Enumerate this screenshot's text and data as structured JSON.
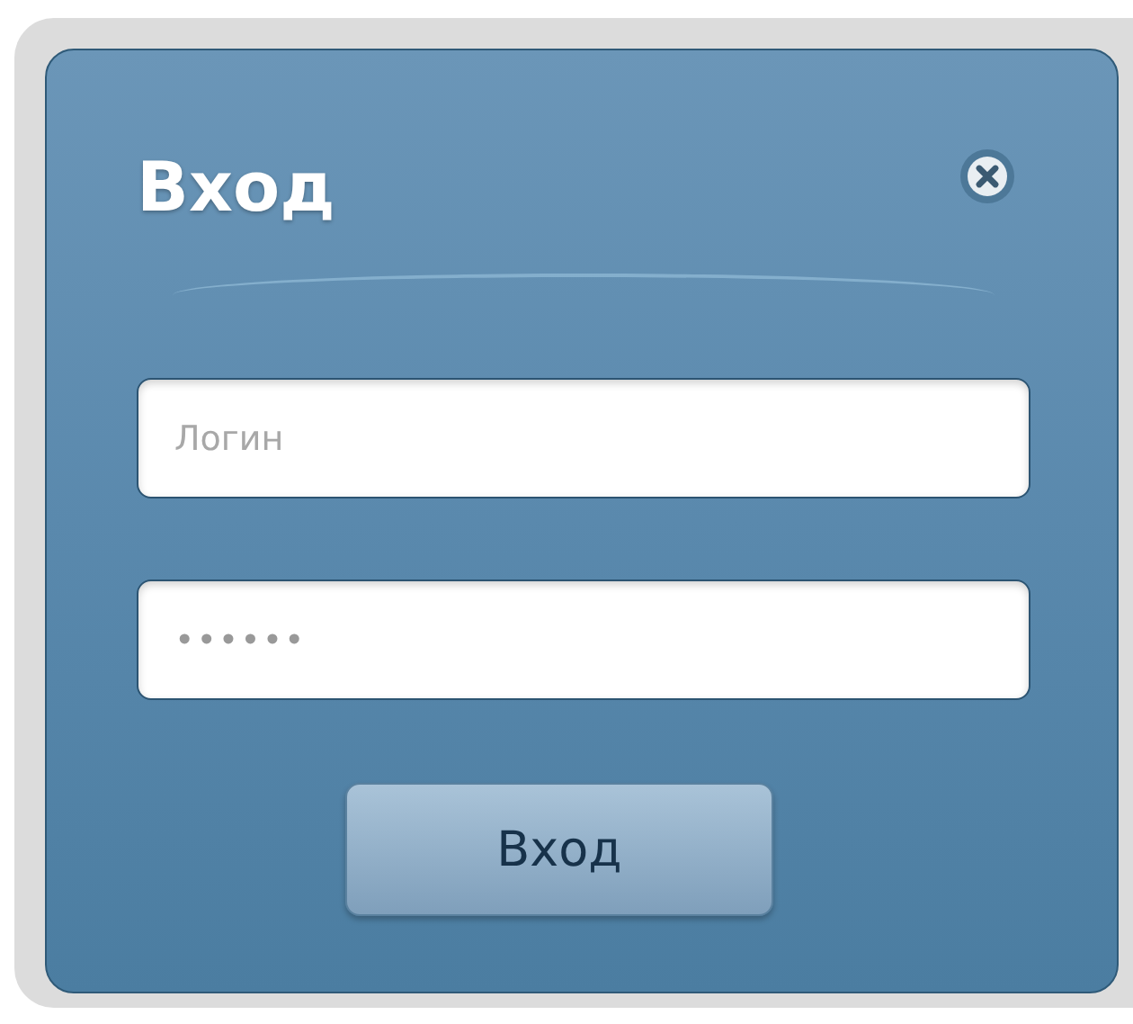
{
  "dialog": {
    "title": "Вход"
  },
  "fields": [
    {
      "kind": "text",
      "placeholder": "Логин"
    },
    {
      "kind": "password",
      "value": "••••••"
    }
  ],
  "submit": {
    "label": "Вход"
  }
}
